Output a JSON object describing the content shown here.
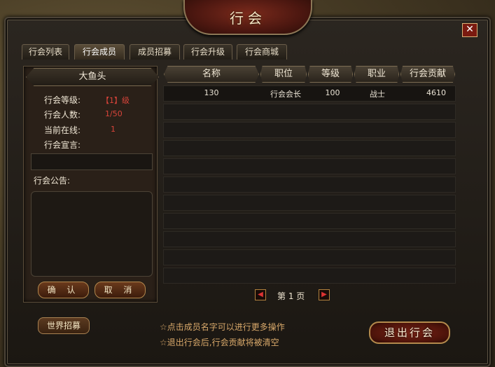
{
  "window": {
    "title": "行会",
    "close_glyph": "✕"
  },
  "tabs": [
    {
      "label": "行会列表",
      "active": false
    },
    {
      "label": "行会成员",
      "active": true
    },
    {
      "label": "成员招募",
      "active": false
    },
    {
      "label": "行会升级",
      "active": false
    },
    {
      "label": "行会商城",
      "active": false
    }
  ],
  "guild": {
    "name": "大鱼头",
    "level_label": "行会等级:",
    "level_value": "【1】级",
    "members_label": "行会人数:",
    "members_value": "1/50",
    "online_label": "当前在线:",
    "online_value": "1",
    "declaration_label": "行会宣言:",
    "notice_label": "行会公告:"
  },
  "buttons": {
    "confirm": "确 认",
    "cancel": "取 消",
    "world_recruit": "世界招募",
    "exit_guild": "退出行会"
  },
  "table": {
    "columns": [
      "名称",
      "职位",
      "等级",
      "职业",
      "行会贡献"
    ],
    "rows": [
      {
        "name": "130",
        "position": "行会会长",
        "level": "100",
        "class": "战士",
        "contribution": "4610"
      }
    ],
    "empty_rows": 10
  },
  "pager": {
    "text": "第 1 页",
    "prev_glyph": "◀",
    "next_glyph": "▶"
  },
  "tips": [
    "☆点击成员名字可以进行更多操作",
    "☆退出行会后,行会贡献将被清空"
  ],
  "colors": {
    "accent_red": "#d9443a",
    "tip_gold": "#d8a86a"
  }
}
